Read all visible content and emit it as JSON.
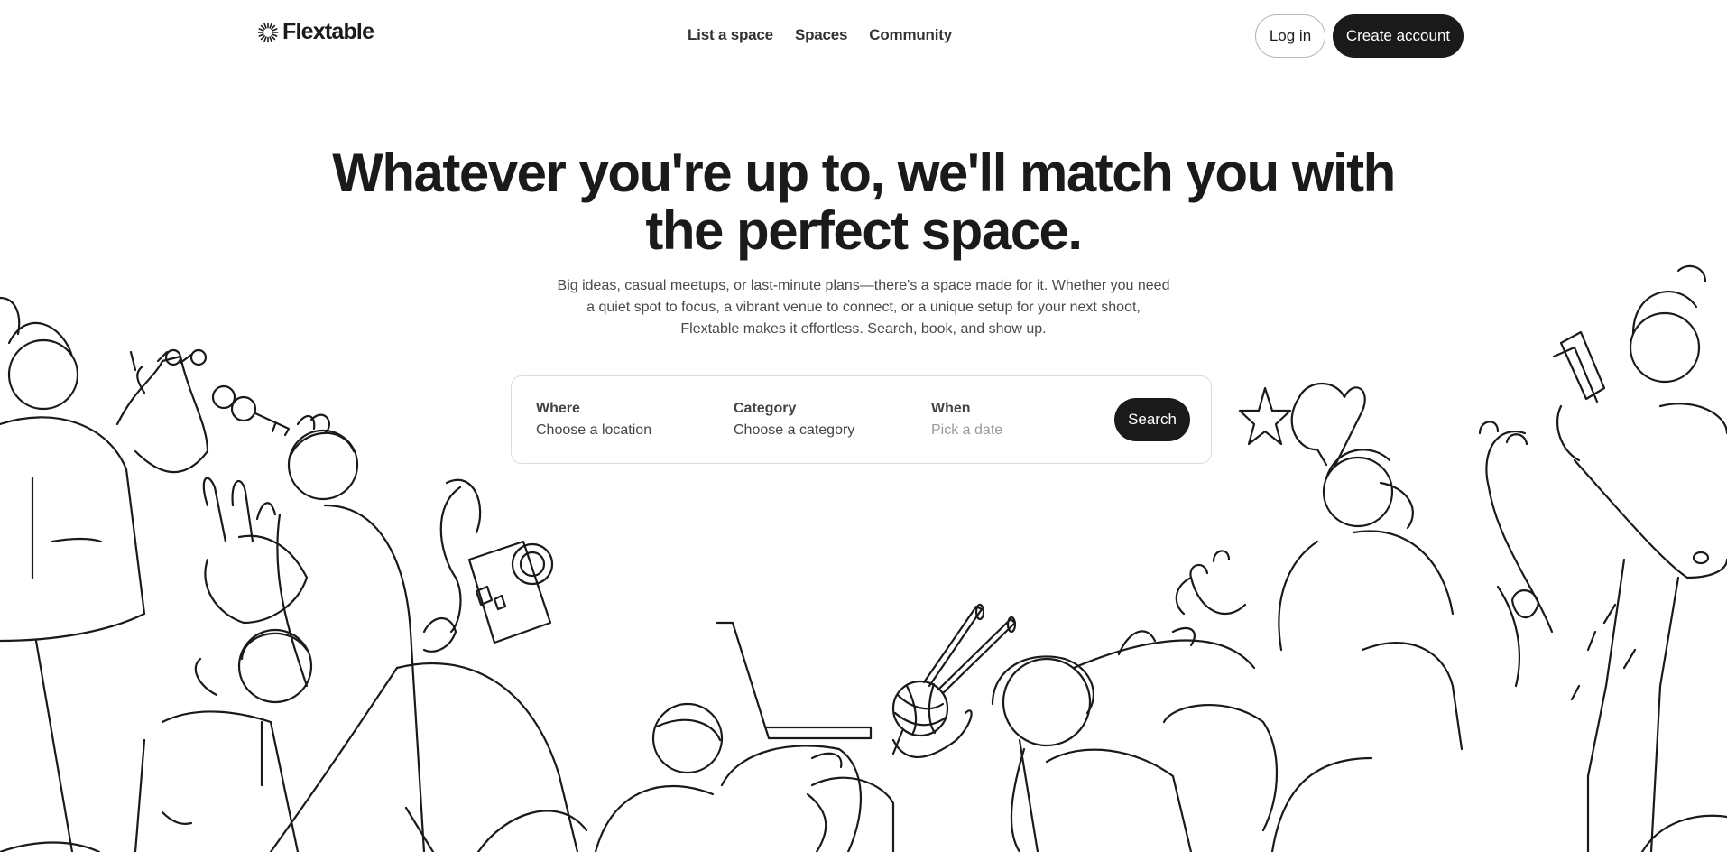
{
  "brand": {
    "name": "Flextable",
    "logo_icon": "sunburst-logo-icon"
  },
  "nav": {
    "links": [
      "List a space",
      "Spaces",
      "Community"
    ],
    "login_label": "Log in",
    "signup_label": "Create account"
  },
  "hero": {
    "title": "Whatever you're up to, we'll match you with the perfect space.",
    "subtitle": "Big ideas, casual meetups, or last-minute plans—there's a space made for it. Whether you need a quiet spot to focus, a vibrant venue to connect, or a unique setup for your next shoot, Flextable makes it effortless. Search, book, and show up."
  },
  "search": {
    "where": {
      "label": "Where",
      "value": "Choose a location"
    },
    "category": {
      "label": "Category",
      "value": "Choose a category"
    },
    "when": {
      "label": "When",
      "placeholder": "Pick a date"
    },
    "button_label": "Search"
  },
  "colors": {
    "ink": "#1a1a1a",
    "background": "#ffffff",
    "muted": "#9a9a9a",
    "border": "#dcdcdc"
  }
}
